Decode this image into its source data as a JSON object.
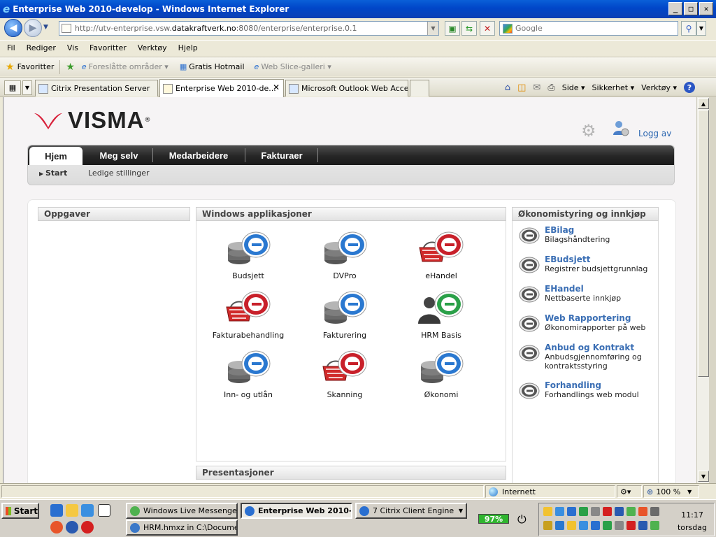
{
  "window": {
    "title": "Enterprise Web 2010-develop - Windows Internet Explorer",
    "min": "_",
    "max": "□",
    "close": "✕"
  },
  "address": {
    "url_prefix": "http://utv-enterprise.vsw.",
    "url_host": "datakraftverk.no",
    "url_suffix": ":8080/enterprise/enterprise.0.1",
    "search_placeholder": "Google"
  },
  "menu": [
    "Fil",
    "Rediger",
    "Vis",
    "Favoritter",
    "Verktøy",
    "Hjelp"
  ],
  "favorites": {
    "label": "Favoritter",
    "items": [
      "Foreslåtte områder ▾",
      "Gratis Hotmail",
      "Web Slice-galleri ▾"
    ]
  },
  "tabs": [
    {
      "label": "Citrix Presentation Server"
    },
    {
      "label": "Enterprise Web 2010-de..."
    },
    {
      "label": "Microsoft Outlook Web Access"
    }
  ],
  "commandbar": [
    "Side ▾",
    "Sikkerhet ▾",
    "Verktøy ▾"
  ],
  "app": {
    "brand": "VISMA",
    "brand_reg": "®",
    "logout": "Logg av",
    "nav_tabs": [
      "Hjem",
      "Meg selv",
      "Medarbeidere",
      "Fakturaer"
    ],
    "sub_nav": [
      "Start",
      "Ledige stillinger"
    ],
    "oppgaver_title": "Oppgaver",
    "windows_title": "Windows applikasjoner",
    "presentasjoner_title": "Presentasjoner",
    "windows_apps": [
      {
        "label": "Budsjett",
        "color": "blue",
        "base": "db"
      },
      {
        "label": "DVPro",
        "color": "blue",
        "base": "db"
      },
      {
        "label": "eHandel",
        "color": "red",
        "base": "basket"
      },
      {
        "label": "Fakturabehandling",
        "color": "red",
        "base": "basket"
      },
      {
        "label": "Fakturering",
        "color": "blue",
        "base": "db"
      },
      {
        "label": "HRM Basis",
        "color": "green",
        "base": "person"
      },
      {
        "label": "Inn- og utlån",
        "color": "blue",
        "base": "db"
      },
      {
        "label": "Skanning",
        "color": "red",
        "base": "basket"
      },
      {
        "label": "Økonomi",
        "color": "blue",
        "base": "db"
      }
    ],
    "okonomi_title": "Økonomistyring og innkjøp",
    "okonomi_items": [
      {
        "title": "EBilag",
        "desc": "Bilagshåndtering"
      },
      {
        "title": "EBudsjett",
        "desc": "Registrer budsjettgrunnlag"
      },
      {
        "title": "EHandel",
        "desc": "Nettbaserte innkjøp"
      },
      {
        "title": "Web Rapportering",
        "desc": "Økonomirapporter på web"
      },
      {
        "title": "Anbud og Kontrakt",
        "desc": "Anbudsgjennomføring og kontraktsstyring"
      },
      {
        "title": "Forhandling",
        "desc": "Forhandlings web modul"
      }
    ]
  },
  "statusbar": {
    "zone": "Internett",
    "zoom": "100 %"
  },
  "taskbar": {
    "start": "Start",
    "buttons": [
      {
        "label": "Windows Live Messenger"
      },
      {
        "label": "Enterprise Web 2010-..."
      },
      {
        "label": "7 Citrix Client Engine"
      },
      {
        "label": "HRM.hmxz in C:\\Docume..."
      }
    ],
    "battery": "97%",
    "time": "11:17",
    "day": "torsdag"
  },
  "colors": {
    "visma_red": "#d8203a",
    "link_blue": "#3a6eb4",
    "ie_title_blue": "#0046c8"
  }
}
